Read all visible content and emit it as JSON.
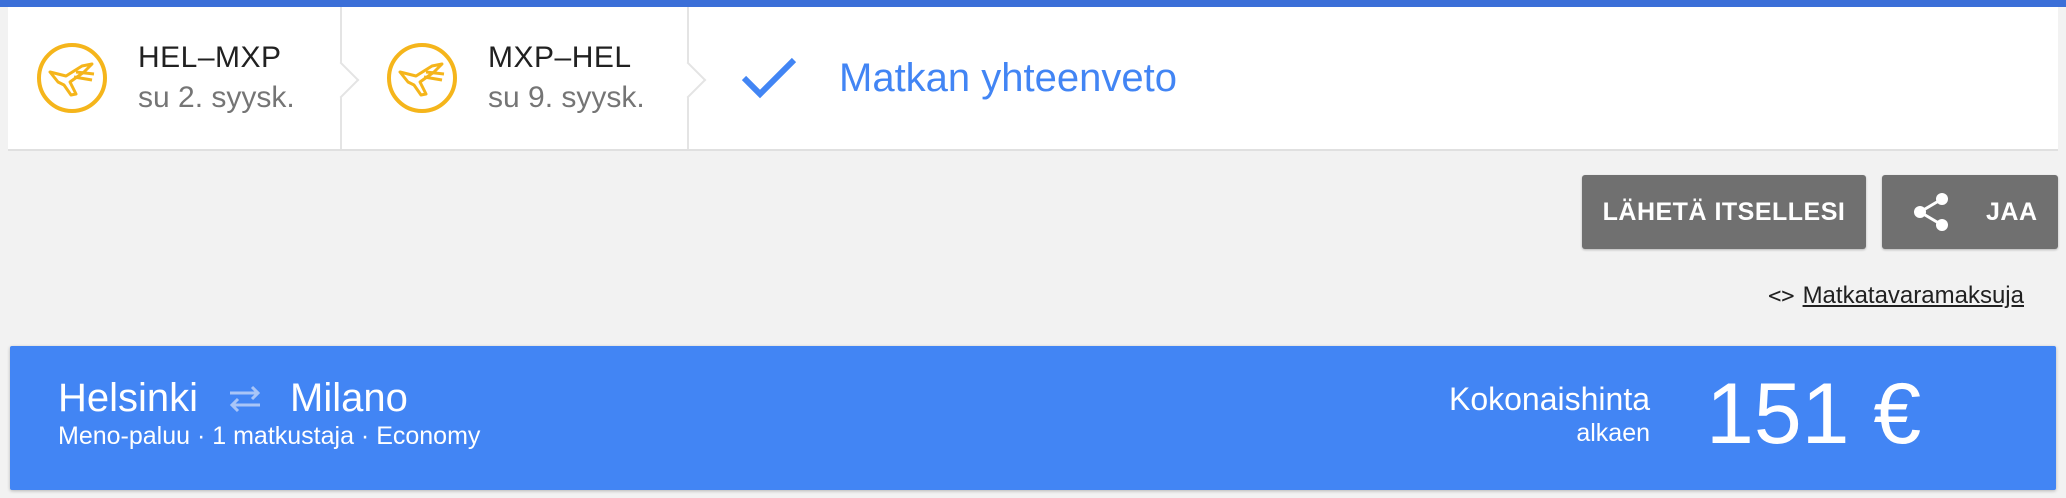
{
  "colors": {
    "accent_blue": "#4285f4",
    "top_bar": "#3b6fd8",
    "logo_yellow": "#f5b51b",
    "button_gray": "#707070",
    "page_bg": "#f2f2f2"
  },
  "steps": [
    {
      "route": "HEL–MXP",
      "date": "su 2. syysk.",
      "icon": "airline-logo-icon"
    },
    {
      "route": "MXP–HEL",
      "date": "su 9. syysk.",
      "icon": "airline-logo-icon"
    },
    {
      "label": "Matkan yhteenveto",
      "icon": "checkmark-icon",
      "active": true
    }
  ],
  "actions": {
    "send_label": "LÄHETÄ ITSELLESI",
    "share_label": "JAA",
    "share_icon": "share-icon"
  },
  "baggage": {
    "icon_text": "<>",
    "link_text": "Matkatavaramaksuja"
  },
  "trip": {
    "origin": "Helsinki",
    "destination": "Milano",
    "swap_icon": "swap-arrows-icon",
    "details": "Meno-paluu · 1 matkustaja · Economy",
    "price_label": "Kokonaishinta",
    "price_sublabel": "alkaen",
    "price": "151 €"
  }
}
